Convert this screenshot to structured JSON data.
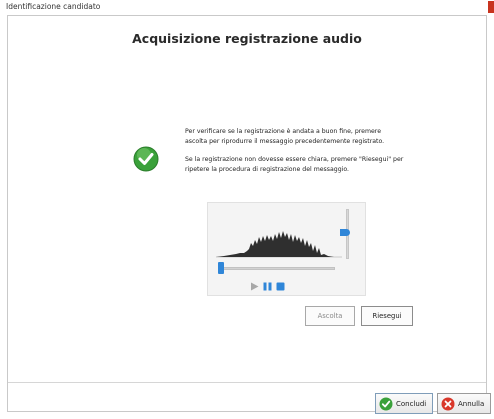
{
  "window": {
    "title": "Identificazione candidato"
  },
  "main": {
    "heading": "Acquisizione registrazione audio",
    "paragraph1": "Per verificare se la registrazione è andata a buon fine, premere ascolta per riprodurre il messaggio precedentemente registrato.",
    "paragraph2": "Se la registrazione non dovesse essere chiara, premere \"Riesegui\" per ripetere la procedura di registrazione del messaggio."
  },
  "audio": {
    "playback_progress_fraction": 0.0,
    "volume_level_fraction": 0.6
  },
  "buttons": {
    "ascolta": "Ascolta",
    "riesegui": "Riesegui",
    "concludi": "Concludi",
    "annulla": "Annulla"
  },
  "icons": {
    "success": "green-check-icon",
    "play": "play-icon",
    "pause": "pause-icon",
    "stop": "stop-icon",
    "close": "close-icon",
    "concludi": "check-icon",
    "annulla": "cancel-icon"
  },
  "colors": {
    "accent": "#2f86d8",
    "success": "#3aa13a",
    "danger": "#d9372a"
  }
}
